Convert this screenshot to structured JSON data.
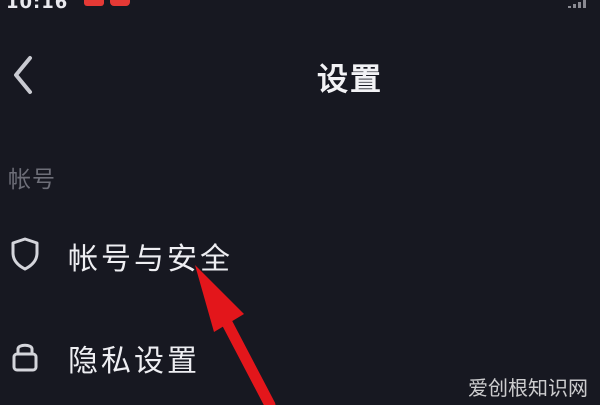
{
  "status_bar": {
    "time": "10:16"
  },
  "nav": {
    "title": "设置",
    "back_icon": "chevron-left-icon"
  },
  "section": {
    "header": "帐号"
  },
  "menu": {
    "items": [
      {
        "label": "帐号与安全",
        "icon": "shield-icon"
      },
      {
        "label": "隐私设置",
        "icon": "lock-icon"
      }
    ]
  },
  "watermark": {
    "text": "爱创根知识网"
  },
  "colors": {
    "background": "#171821",
    "text": "#eeeef2",
    "muted": "#6d6e78",
    "annotation_arrow": "#e3161b"
  }
}
